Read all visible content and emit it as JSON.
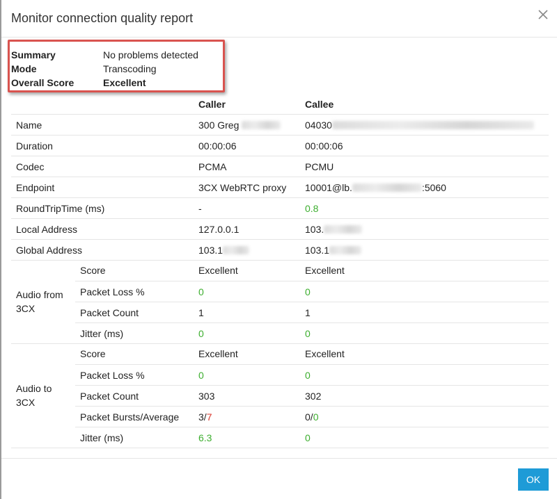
{
  "dialog": {
    "title": "Monitor connection quality report",
    "ok_label": "OK"
  },
  "summary": {
    "summary_label": "Summary",
    "summary_value": "No problems detected",
    "mode_label": "Mode",
    "mode_value": "Transcoding",
    "score_label": "Overall Score",
    "score_value": "Excellent"
  },
  "table": {
    "caller_header": "Caller",
    "callee_header": "Callee",
    "rows": [
      {
        "label": "Name",
        "caller": "300 Greg",
        "callee": "04030"
      },
      {
        "label": "Duration",
        "caller": "00:00:06",
        "callee": "00:00:06"
      },
      {
        "label": "Codec",
        "caller": "PCMA",
        "callee": "PCMU"
      },
      {
        "label": "Endpoint",
        "caller": "3CX WebRTC proxy",
        "callee_prefix": "10001@lb.",
        "callee_suffix": ":5060"
      },
      {
        "label": "RoundTripTime (ms)",
        "caller": "-",
        "callee": "0.8"
      },
      {
        "label": "Local Address",
        "caller": "127.0.0.1",
        "callee": "103."
      },
      {
        "label": "Global Address",
        "caller": "103.1",
        "callee": "103.1"
      }
    ],
    "audio_from": {
      "group_label": "Audio from 3CX",
      "rows": [
        {
          "label": "Score",
          "caller": "Excellent",
          "callee": "Excellent"
        },
        {
          "label": "Packet Loss %",
          "caller": "0",
          "callee": "0"
        },
        {
          "label": "Packet Count",
          "caller": "1",
          "callee": "1"
        },
        {
          "label": "Jitter (ms)",
          "caller": "0",
          "callee": "0"
        }
      ]
    },
    "audio_to": {
      "group_label": "Audio to 3CX",
      "rows": [
        {
          "label": "Score",
          "caller": "Excellent",
          "callee": "Excellent"
        },
        {
          "label": "Packet Loss %",
          "caller": "0",
          "callee": "0"
        },
        {
          "label": "Packet Count",
          "caller": "303",
          "callee": "302"
        },
        {
          "label": "Packet Bursts/Average",
          "caller_bursts": "3/",
          "caller_avg": "7",
          "callee_bursts": "0/",
          "callee_avg": "0"
        },
        {
          "label": "Jitter (ms)",
          "caller": "6.3",
          "callee": "0"
        }
      ]
    }
  },
  "colors": {
    "good": "#3cae2e",
    "bad": "#d9362b",
    "accent": "#1e9bd7",
    "highlight_border": "#d9534f"
  },
  "icons": {
    "close": "close-icon"
  }
}
